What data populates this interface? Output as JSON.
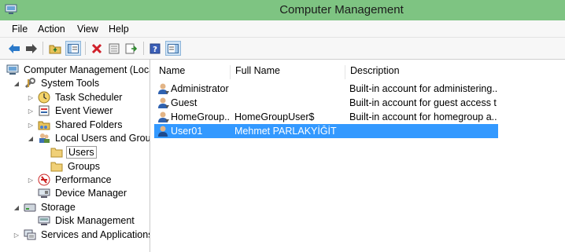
{
  "window": {
    "title": "Computer Management"
  },
  "menu": [
    {
      "label": "File"
    },
    {
      "label": "Action"
    },
    {
      "label": "View"
    },
    {
      "label": "Help"
    }
  ],
  "toolbar": {
    "buttons": [
      "back-icon",
      "forward-icon",
      "up-folder-icon",
      "show-hide-tree-icon",
      "delete-icon",
      "properties-icon",
      "export-list-icon",
      "help-icon",
      "show-hide-action-pane-icon"
    ]
  },
  "tree": {
    "items": [
      {
        "label": "Computer Management (Local"
      },
      {
        "label": "System Tools"
      },
      {
        "label": "Task Scheduler"
      },
      {
        "label": "Event Viewer"
      },
      {
        "label": "Shared Folders"
      },
      {
        "label": "Local Users and Groups"
      },
      {
        "label": "Users"
      },
      {
        "label": "Groups"
      },
      {
        "label": "Performance"
      },
      {
        "label": "Device Manager"
      },
      {
        "label": "Storage"
      },
      {
        "label": "Disk Management"
      },
      {
        "label": "Services and Applications"
      }
    ]
  },
  "list": {
    "columns": [
      {
        "label": "Name"
      },
      {
        "label": "Full Name"
      },
      {
        "label": "Description"
      }
    ],
    "rows": [
      {
        "name": "Administrator",
        "full_name": "",
        "description": "Built-in account for administering..."
      },
      {
        "name": "Guest",
        "full_name": "",
        "description": "Built-in account for guest access t..."
      },
      {
        "name": "HomeGroup...",
        "full_name": "HomeGroupUser$",
        "description": "Built-in account for homegroup a..."
      },
      {
        "name": "User01",
        "full_name": "Mehmet PARLAKYİĞİT",
        "description": ""
      }
    ],
    "selected_row": 3
  },
  "colors": {
    "titlebar": "#7ec482",
    "selection": "#3399ff"
  }
}
